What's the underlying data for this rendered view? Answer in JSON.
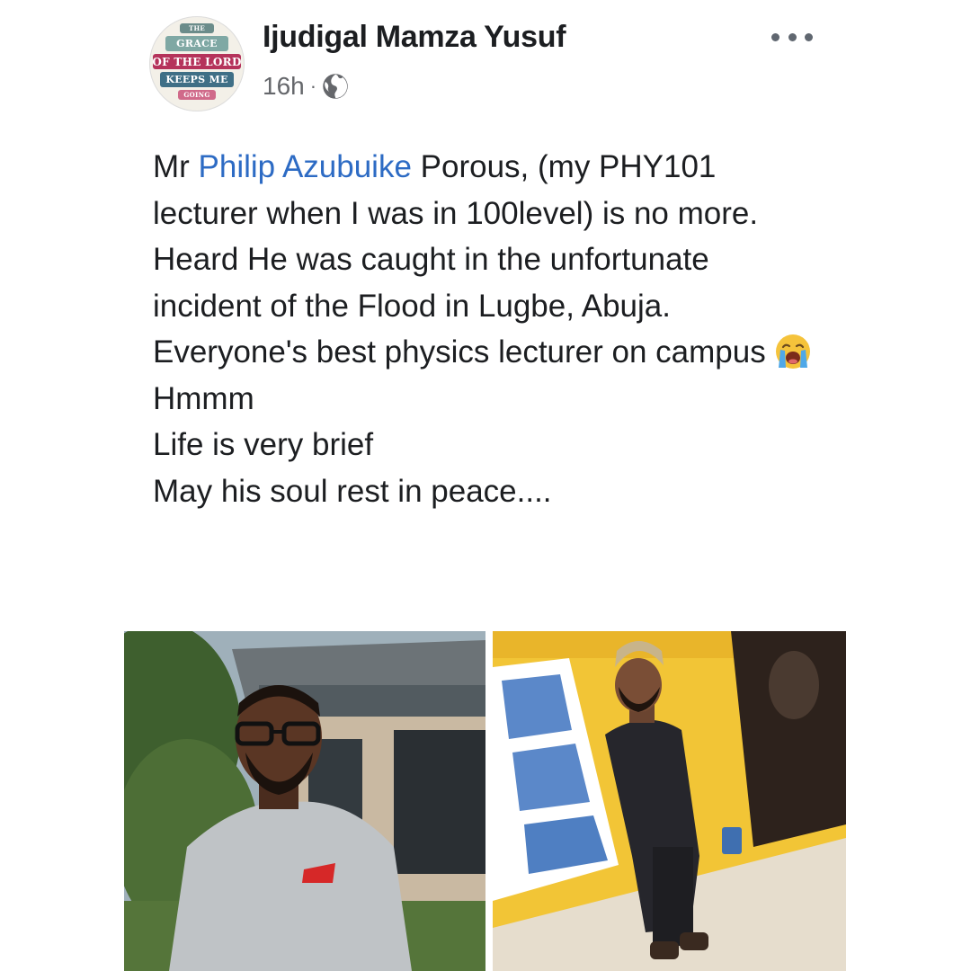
{
  "post": {
    "avatar_text": [
      "THE",
      "GRACE",
      "OF THE LORD",
      "KEEPS ME",
      "GOING"
    ],
    "author": "Ijudigal Mamza Yusuf",
    "time": "16h",
    "separator": "·",
    "privacy_icon": "globe-icon",
    "more_icon": "more-options-icon",
    "text": {
      "line1_prefix": "Mr ",
      "mention": "Philip Azubuike",
      "line1_suffix": " Porous, (my PHY101 lecturer when I was in 100level) is no more.",
      "line2": "Heard He was caught in the unfortunate incident of the Flood in Lugbe, Abuja.",
      "line3": "Everyone's best physics lecturer on campus",
      "emoji": "loudly-crying-face-emoji",
      "line4": "Hmmm",
      "line5": "Life is very brief",
      "line6": "May his soul rest in peace...."
    },
    "photos": [
      {
        "subject": "man-in-grey-kaftan-with-glasses"
      },
      {
        "subject": "man-in-black-kaftan-and-cap"
      }
    ]
  },
  "colors": {
    "author_text": "#1c1e21",
    "meta_text": "#65676b",
    "mention_link": "#2d6bc4",
    "background": "#ffffff"
  }
}
